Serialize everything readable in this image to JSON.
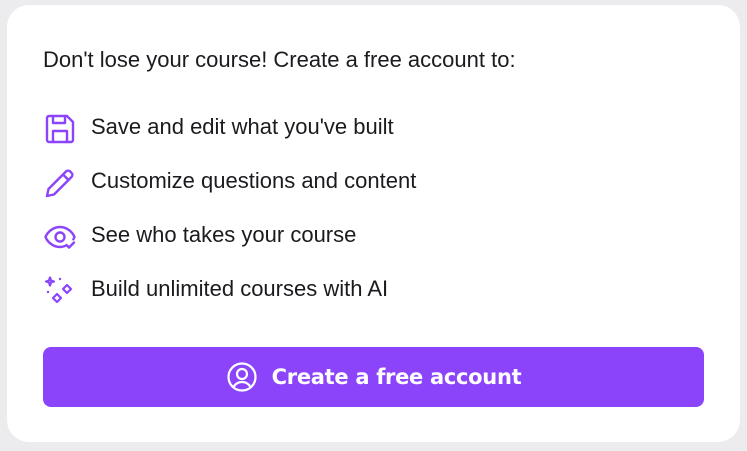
{
  "card": {
    "headline": "Don't lose your course! Create a free account to:",
    "features": [
      {
        "icon": "floppy-disk-icon",
        "label": "Save and edit what you've built"
      },
      {
        "icon": "pencil-icon",
        "label": "Customize questions and content"
      },
      {
        "icon": "eye-check-icon",
        "label": "See who takes your course"
      },
      {
        "icon": "sparkles-icon",
        "label": "Build unlimited courses with AI"
      }
    ],
    "cta": {
      "icon": "user-circle-icon",
      "label": "Create a free account"
    }
  },
  "colors": {
    "accent": "#8c44fb",
    "icon": "#8c44fb",
    "text": "#1b1b1f",
    "background": "#ececef",
    "card": "#ffffff"
  }
}
